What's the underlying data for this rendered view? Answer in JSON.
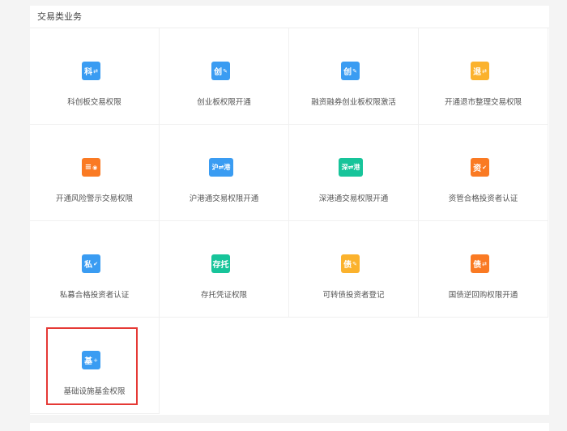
{
  "section_title": "交易类业务",
  "items": [
    {
      "label": "科创板交易权限",
      "icon": "科",
      "glyph": "⇄",
      "color": "#3a9cf2",
      "name": "star-market"
    },
    {
      "label": "创业板权限开通",
      "icon": "创",
      "glyph": "✎",
      "color": "#3a9cf2",
      "name": "chinext"
    },
    {
      "label": "融资融券创业板权限激活",
      "icon": "创",
      "glyph": "✎",
      "color": "#3a9cf2",
      "name": "margin-chinext"
    },
    {
      "label": "开通退市整理交易权限",
      "icon": "退",
      "glyph": "⇄",
      "color": "#fbb22d",
      "name": "delisting"
    },
    {
      "label": "开通风险警示交易权限",
      "icon": "≡",
      "glyph": "◉",
      "color": "#fa7a23",
      "name": "risk-warning"
    },
    {
      "label": "沪港通交易权限开通",
      "icon": "沪⇌港",
      "glyph": "",
      "color": "#3a9cf2",
      "name": "sh-hk-connect"
    },
    {
      "label": "深港通交易权限开通",
      "icon": "深⇌港",
      "glyph": "",
      "color": "#17c49a",
      "name": "sz-hk-connect"
    },
    {
      "label": "资管合格投资者认证",
      "icon": "资",
      "glyph": "✔",
      "color": "#fa7a23",
      "name": "asset-mgmt-investor"
    },
    {
      "label": "私募合格投资者认证",
      "icon": "私",
      "glyph": "✔",
      "color": "#3a9cf2",
      "name": "private-fund-investor"
    },
    {
      "label": "存托凭证权限",
      "icon": "存托",
      "glyph": "",
      "color": "#17c49a",
      "name": "depositary-receipt"
    },
    {
      "label": "可转债投资者登记",
      "icon": "债",
      "glyph": "✎",
      "color": "#fbb22d",
      "name": "convertible-bond"
    },
    {
      "label": "国债逆回购权限开通",
      "icon": "债",
      "glyph": "⇄",
      "color": "#fa7a23",
      "name": "treasury-repo"
    },
    {
      "label": "基础设施基金权限",
      "icon": "基",
      "glyph": "+",
      "color": "#3a9cf2",
      "name": "infra-fund"
    }
  ]
}
